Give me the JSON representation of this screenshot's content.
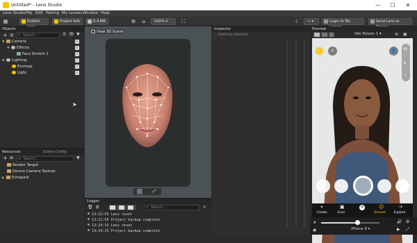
{
  "window": {
    "title": "Untitled* - Lens Studio",
    "min": "—",
    "max": "☐",
    "close": "✕"
  },
  "menu": [
    "Lens Studio",
    "File",
    "Edit",
    "Pairing",
    "My Lenses",
    "Window",
    "Help"
  ],
  "toolbar": {
    "publish": "Publish Lens",
    "project_info": "Project Info",
    "size": "0.4 MB",
    "zoom": "100%",
    "login": "Login to My Lenses",
    "send": "Send Lens to Device"
  },
  "objects_panel": {
    "title": "Objects",
    "search_placeholder": "Search...",
    "tree": [
      {
        "label": "Camera",
        "depth": 0,
        "expanded": true
      },
      {
        "label": "Effects",
        "depth": 1,
        "expanded": true
      },
      {
        "label": "Face Stretch 1",
        "depth": 2
      },
      {
        "label": "Lighting",
        "depth": 0,
        "expanded": true
      },
      {
        "label": "Envmap",
        "depth": 1
      },
      {
        "label": "Light",
        "depth": 1
      }
    ]
  },
  "resources_panel": {
    "tabs": [
      "Resources",
      "Scene Config"
    ],
    "search_placeholder": "Search...",
    "items": [
      "Render Target",
      "Device Camera Texture",
      "Echopark"
    ]
  },
  "scene_panel": {
    "view3d": "View 3D Scene"
  },
  "logger": {
    "title": "Logger",
    "search_placeholder": "Search...",
    "lines": [
      {
        "time": "13:22:55",
        "msg": "Lens reset"
      },
      {
        "time": "13:22:55",
        "msg": "Project backup complete"
      },
      {
        "time": "13:24:15",
        "msg": "Lens reset"
      },
      {
        "time": "13:24:15",
        "msg": "Project backup complete"
      }
    ]
  },
  "inspector": {
    "title": "Inspector",
    "empty": "Nothing selected"
  },
  "preview": {
    "title": "Preview",
    "person": "Idle Person 1",
    "device": "iPhone 8",
    "nav": [
      "Create",
      "Scan",
      "",
      "Browse",
      "Explore"
    ]
  }
}
